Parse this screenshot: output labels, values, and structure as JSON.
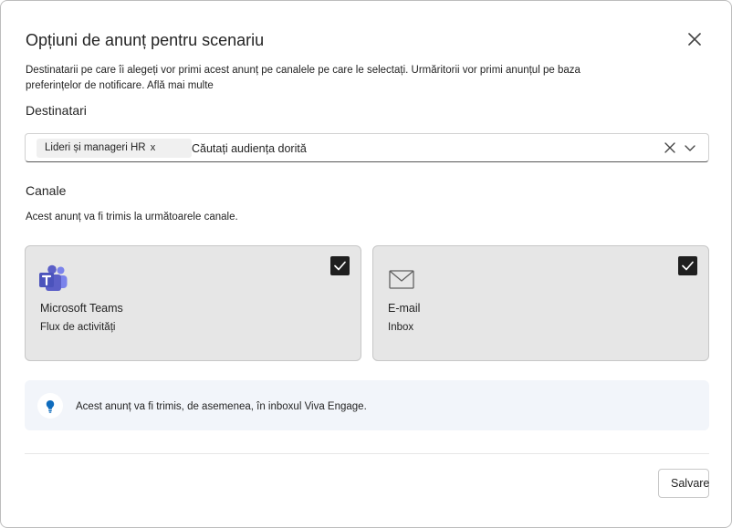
{
  "dialog": {
    "title": "Opțiuni de anunț pentru scenariu",
    "description": "Destinatarii pe care îi alegeți vor primi acest anunț pe canalele pe care le selectați. Urmăritorii vor primi anunțul pe baza preferințelor de notificare.",
    "learn_more": "Află mai multe",
    "close_icon": "close-icon"
  },
  "recipients": {
    "label": "Destinatari",
    "chip": "Lideri și manageri HR",
    "chip_remove": "x",
    "placeholder": "Căutați audiența dorită"
  },
  "channels": {
    "label": "Canale",
    "description": "Acest anunț va fi trimis la următoarele canale.",
    "cards": [
      {
        "name": "Microsoft Teams",
        "sub": "Flux de activități",
        "icon": "teams-icon",
        "checked": true,
        "accent": "#5b5fc7"
      },
      {
        "name": "E-mail",
        "sub": "Inbox",
        "icon": "mail-icon",
        "checked": true
      }
    ]
  },
  "info": {
    "icon": "lightbulb-icon",
    "text": "Acest anunț va fi trimis, de asemenea, în inboxul Viva Engage.",
    "accent": "#0f6cbd"
  },
  "footer": {
    "save_label": "Salvare"
  }
}
